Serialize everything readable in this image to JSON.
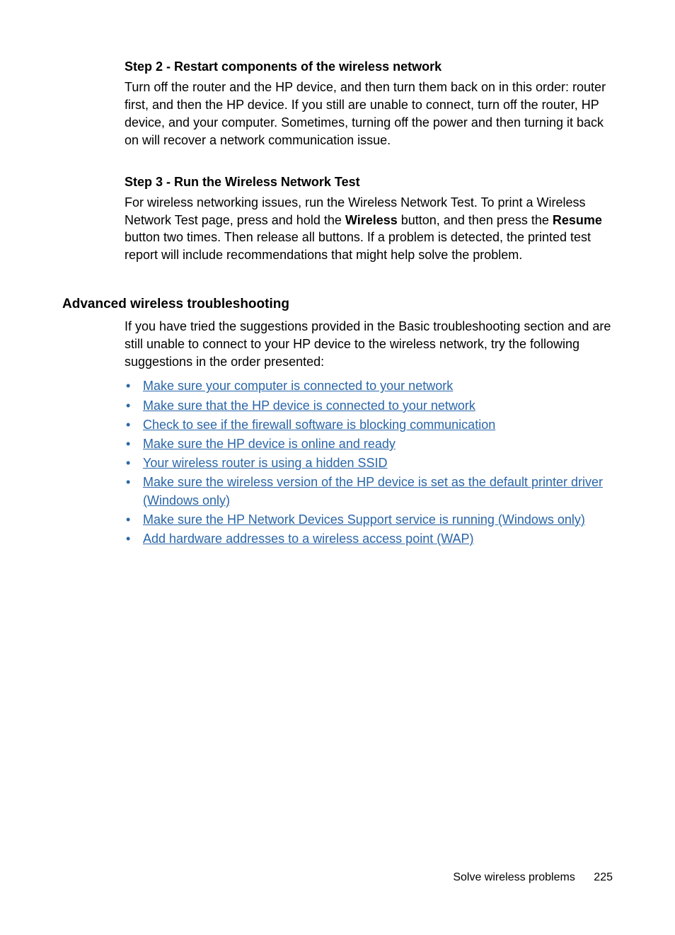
{
  "step2": {
    "title": "Step 2 - Restart components of the wireless network",
    "body": "Turn off the router and the HP device, and then turn them back on in this order: router first, and then the HP device. If you still are unable to connect, turn off the router, HP device, and your computer. Sometimes, turning off the power and then turning it back on will recover a network communication issue."
  },
  "step3": {
    "title": "Step 3 - Run the Wireless Network Test",
    "body_pre": "For wireless networking issues, run the Wireless Network Test. To print a Wireless Network Test page, press and hold the ",
    "bold1": "Wireless",
    "body_mid": " button, and then press the ",
    "bold2": "Resume",
    "body_post": " button two times. Then release all buttons. If a problem is detected, the printed test report will include recommendations that might help solve the problem."
  },
  "section": {
    "heading": "Advanced wireless troubleshooting",
    "intro": "If you have tried the suggestions provided in the Basic troubleshooting section and are still unable to connect to your HP device to the wireless network, try the following suggestions in the order presented:"
  },
  "links": {
    "l0": "Make sure your computer is connected to your network",
    "l1": "Make sure that the HP device is connected to your network",
    "l2": "Check to see if the firewall software is blocking communication",
    "l3": "Make sure the HP device is online and ready",
    "l4": "Your wireless router is using a hidden SSID",
    "l5": "Make sure the wireless version of the HP device is set as the default printer driver (Windows only)",
    "l6": "Make sure the HP Network Devices Support service is running (Windows only)",
    "l7": "Add hardware addresses to a wireless access point (WAP)"
  },
  "footer": {
    "section": "Solve wireless problems",
    "page": "225"
  }
}
